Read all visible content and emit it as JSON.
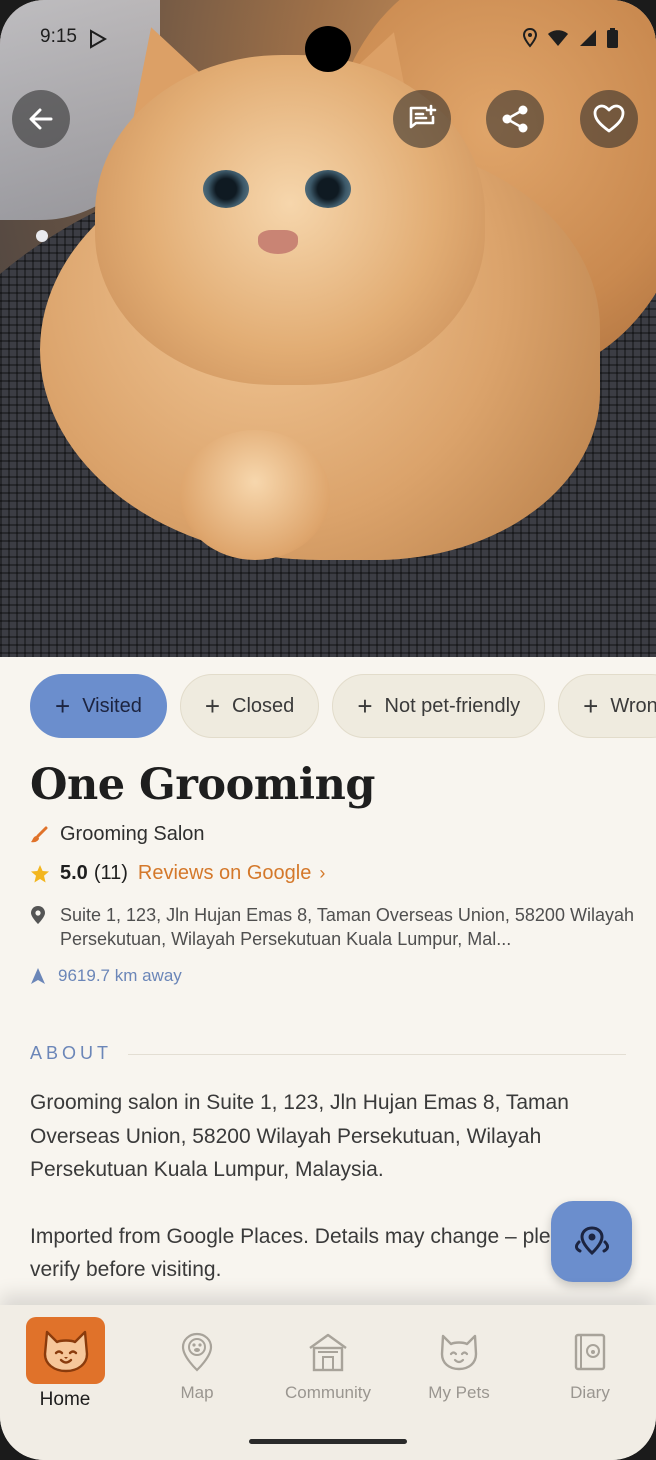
{
  "status": {
    "time": "9:15"
  },
  "chips": [
    {
      "label": "Visited"
    },
    {
      "label": "Closed"
    },
    {
      "label": "Not pet-friendly"
    },
    {
      "label": "Wron"
    }
  ],
  "place": {
    "name": "One Grooming",
    "category": "Grooming Salon",
    "rating": "5.0",
    "review_count": "(11)",
    "reviews_link": "Reviews on Google",
    "address": "Suite 1, 123, Jln Hujan Emas 8, Taman Overseas Union, 58200 Wilayah Persekutuan, Wilayah Persekutuan Kuala Lumpur, Mal...",
    "distance": "9619.7 km away"
  },
  "about": {
    "heading": "ABOUT",
    "paragraph1": "Grooming salon in Suite 1, 123, Jln Hujan Emas 8, Taman Overseas Union, 58200 Wilayah Persekutuan, Wilayah Persekutuan Kuala Lumpur, Malaysia.",
    "paragraph2": "Imported from Google Places. Details may change – please verify before visiting."
  },
  "nav": {
    "home": "Home",
    "map": "Map",
    "community": "Community",
    "my_pets": "My Pets",
    "diary": "Diary"
  },
  "colors": {
    "accent_blue": "#6b8ecd",
    "accent_orange": "#e0722a",
    "link_orange": "#d4782a",
    "background": "#f8f5ef"
  },
  "icons": [
    "back-arrow-icon",
    "add-review-icon",
    "share-icon",
    "heart-icon",
    "brush-icon",
    "star-icon",
    "location-pin-icon",
    "navigation-arrow-icon",
    "map-location-icon",
    "cat-face-icon",
    "map-pin-paw-icon",
    "community-house-icon",
    "cat-icon",
    "diary-book-icon"
  ]
}
